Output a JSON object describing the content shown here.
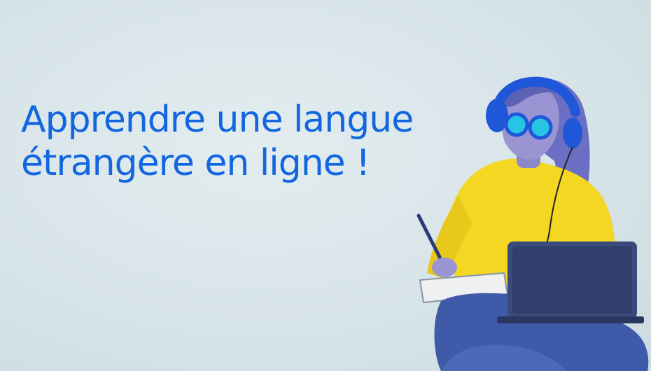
{
  "headline": {
    "line1": "Apprendre une langue",
    "line2": "étrangère en ligne !"
  },
  "colors": {
    "background": "#dbe7ea",
    "headline": "#1266e0",
    "sweater": "#f3d722",
    "headphones": "#1f57d8",
    "jeans": "#3f5aa8",
    "laptop": "#3a4a7a"
  }
}
